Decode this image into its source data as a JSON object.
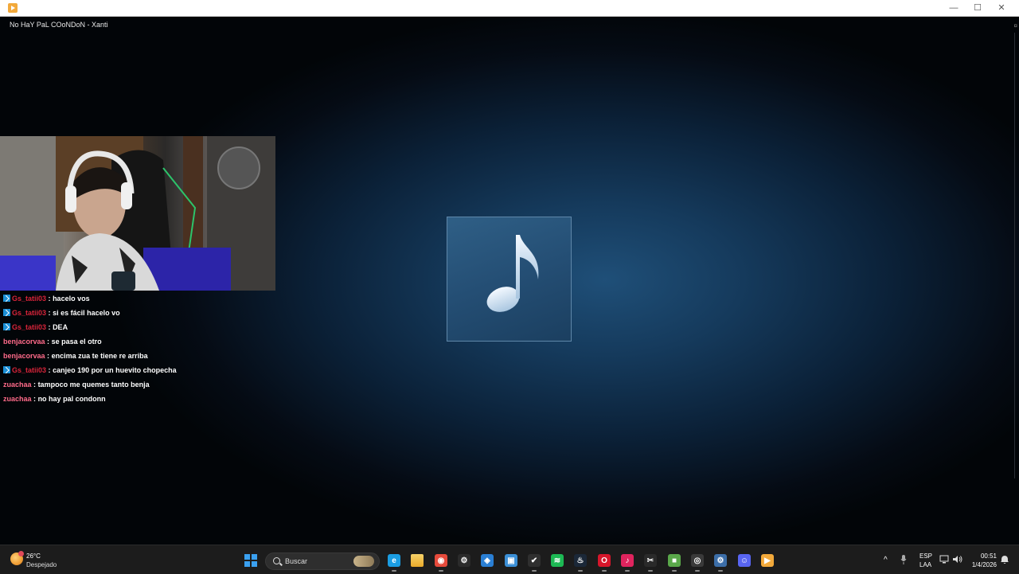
{
  "window": {
    "minimize_glyph": "—",
    "maximize_glyph": "☐",
    "close_glyph": "✕"
  },
  "player": {
    "track_title": "No HaY PaL COoNDoN - Xanti",
    "edge_mark": "¤"
  },
  "chat": [
    {
      "badge": true,
      "user": "Gs_tatii03",
      "text": "hacelo vos"
    },
    {
      "badge": true,
      "user": "Gs_tatii03",
      "text": "si es fácil hacelo vo"
    },
    {
      "badge": true,
      "user": "Gs_tatii03",
      "text": "DEA"
    },
    {
      "badge": false,
      "user": "benjacorvaa",
      "text": "se pasa el otro"
    },
    {
      "badge": false,
      "user": "benjacorvaa",
      "text": "encima zua te tiene re arriba"
    },
    {
      "badge": true,
      "user": "Gs_tatii03",
      "text": "canjeo 190 por un huevito chopecha"
    },
    {
      "badge": false,
      "user": "zuachaa",
      "text": "tampoco me quemes tanto benja"
    },
    {
      "badge": false,
      "user": "zuachaa",
      "text": "no hay pal condonn"
    }
  ],
  "chat_separator": ":",
  "taskbar": {
    "weather_temp": "26°C",
    "weather_desc": "Despejado",
    "search_placeholder": "Buscar",
    "apps": [
      {
        "name": "edge-icon",
        "color": "#1b9de2",
        "glyph": "e"
      },
      {
        "name": "file-explorer-icon",
        "color": "#f4c34a",
        "glyph": ""
      },
      {
        "name": "chrome-icon",
        "color": "#e64a3b",
        "glyph": "◉"
      },
      {
        "name": "steelseries-icon",
        "color": "#2b2b2b",
        "glyph": "⚙"
      },
      {
        "name": "app-sync-icon",
        "color": "#2a7fd4",
        "glyph": "◈"
      },
      {
        "name": "app-window-icon",
        "color": "#3b8fd6",
        "glyph": "▣"
      },
      {
        "name": "nvidia-icon",
        "color": "#2f2f2f",
        "glyph": "✔"
      },
      {
        "name": "spotify-icon",
        "color": "#1db954",
        "glyph": "≋"
      },
      {
        "name": "steam-icon",
        "color": "#1b2838",
        "glyph": "♨"
      },
      {
        "name": "opera-icon",
        "color": "#d6162b",
        "glyph": "O"
      },
      {
        "name": "tiktok-icon",
        "color": "#e0245e",
        "glyph": "♪"
      },
      {
        "name": "capcut-icon",
        "color": "#2a2a2a",
        "glyph": "✂"
      },
      {
        "name": "game-app-icon",
        "color": "#5aa84a",
        "glyph": "■"
      },
      {
        "name": "obs-icon",
        "color": "#3a3a3a",
        "glyph": "◎"
      },
      {
        "name": "settings-icon",
        "color": "#3c6ea8",
        "glyph": "⚙"
      },
      {
        "name": "discord-icon",
        "color": "#5865f2",
        "glyph": "☺"
      },
      {
        "name": "media-player-icon",
        "color": "#f2a93b",
        "glyph": "▶"
      }
    ],
    "tray": {
      "chevron": "^",
      "lang_top": "ESP",
      "lang_bottom": "LAA",
      "time": "00:51",
      "date": "1/4/2026"
    }
  }
}
